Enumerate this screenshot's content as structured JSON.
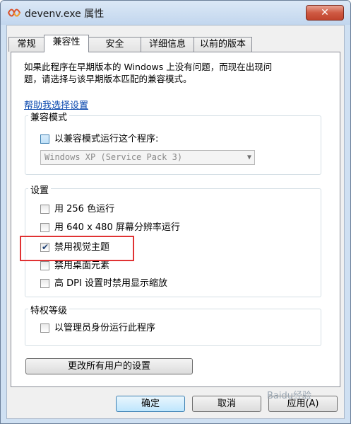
{
  "window": {
    "title": "devenv.exe 属性",
    "close_glyph": "✕"
  },
  "tabs": [
    {
      "label": "常规"
    },
    {
      "label": "兼容性"
    },
    {
      "label": "安全"
    },
    {
      "label": "详细信息"
    },
    {
      "label": "以前的版本"
    }
  ],
  "description": {
    "line1": "如果此程序在早期版本的 Windows 上没有问题，而现在出现问",
    "line2": "题，请选择与该早期版本匹配的兼容模式。"
  },
  "help_link": "帮助我选择设置",
  "compat_mode": {
    "group_label": "兼容模式",
    "checkbox_label": "以兼容模式运行这个程序:",
    "checked": false,
    "select_value": "Windows XP (Service Pack 3)"
  },
  "settings": {
    "group_label": "设置",
    "items": [
      {
        "label": "用 256 色运行",
        "checked": false
      },
      {
        "label": "用 640 x 480 屏幕分辨率运行",
        "checked": false
      },
      {
        "label": "禁用视觉主题",
        "checked": true
      },
      {
        "label": "禁用桌面元素",
        "checked": false
      },
      {
        "label": "高 DPI 设置时禁用显示缩放",
        "checked": false
      }
    ]
  },
  "privilege": {
    "group_label": "特权等级",
    "checkbox_label": "以管理员身份运行此程序",
    "checked": false
  },
  "buttons": {
    "change_all_users": "更改所有用户的设置",
    "ok": "确定",
    "cancel": "取消",
    "apply": "应用(A)"
  },
  "checkmark_glyph": "✔",
  "dropdown_glyph": "▼",
  "watermark": "Baidu经验",
  "colors": {
    "highlight_border": "#e03233",
    "link": "#0645ad",
    "close_button": "#c0432c"
  }
}
